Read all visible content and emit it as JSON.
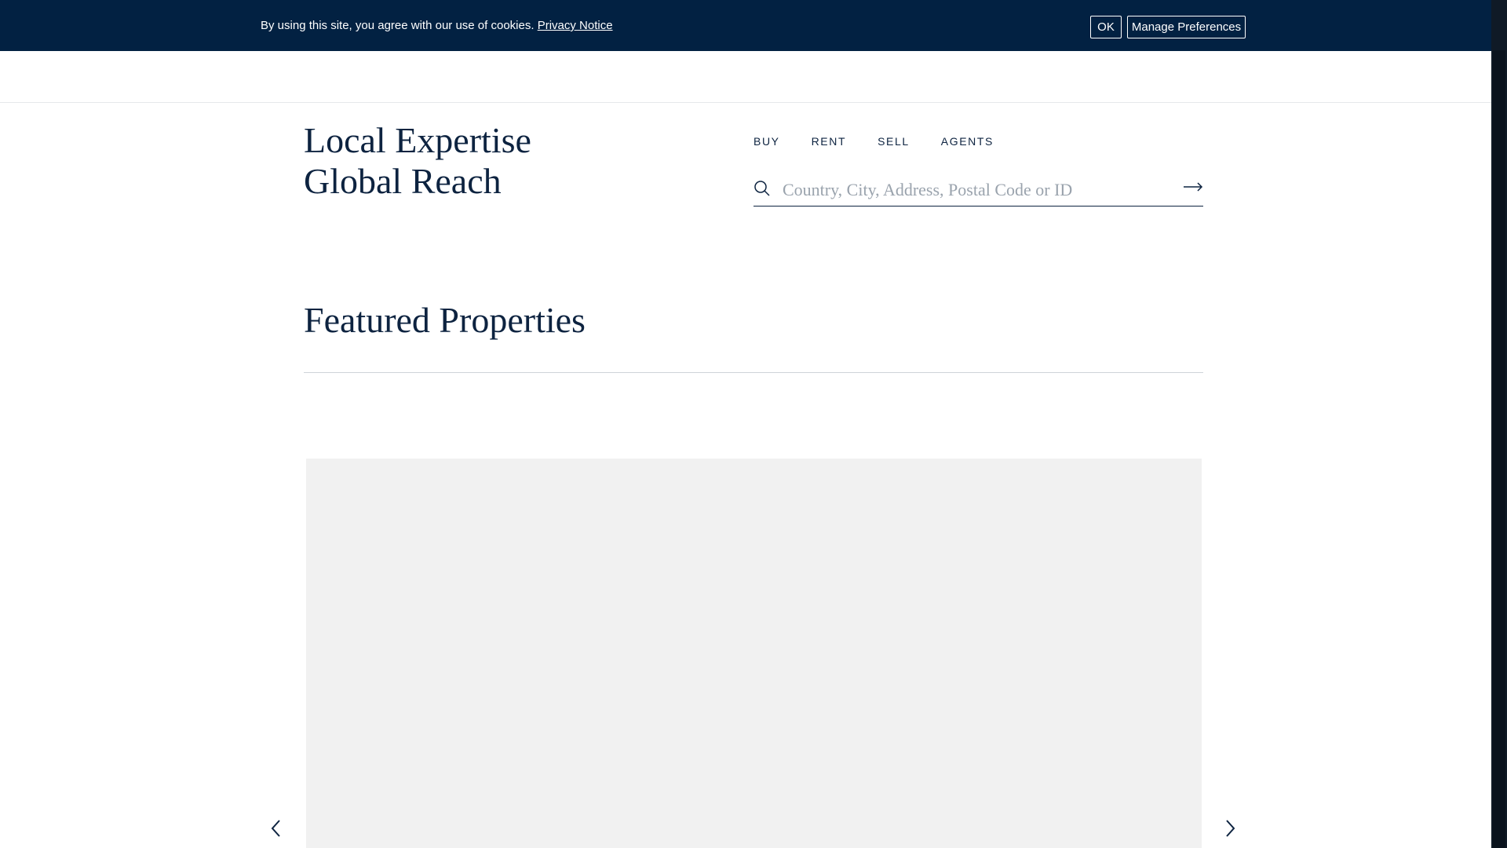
{
  "cookie_banner": {
    "message": "By using this site, you agree with our use of cookies.",
    "privacy_link": "Privacy Notice",
    "ok_label": "OK",
    "manage_label": "Manage Preferences",
    "background": "#022142"
  },
  "hero": {
    "line1": "Local Expertise",
    "line2": "Global Reach"
  },
  "nav": {
    "items": [
      "BUY",
      "RENT",
      "SELL",
      "AGENTS"
    ]
  },
  "search": {
    "placeholder": "Country, City, Address, Postal Code or ID",
    "icon": "search-icon",
    "submit_icon": "arrow-right-icon"
  },
  "featured": {
    "title": "Featured Properties"
  },
  "carousel": {
    "prev_icon": "chevron-left-icon",
    "next_icon": "chevron-right-icon"
  },
  "colors": {
    "brand_navy": "#0d2340",
    "image_placeholder": "#f1f1f1"
  }
}
